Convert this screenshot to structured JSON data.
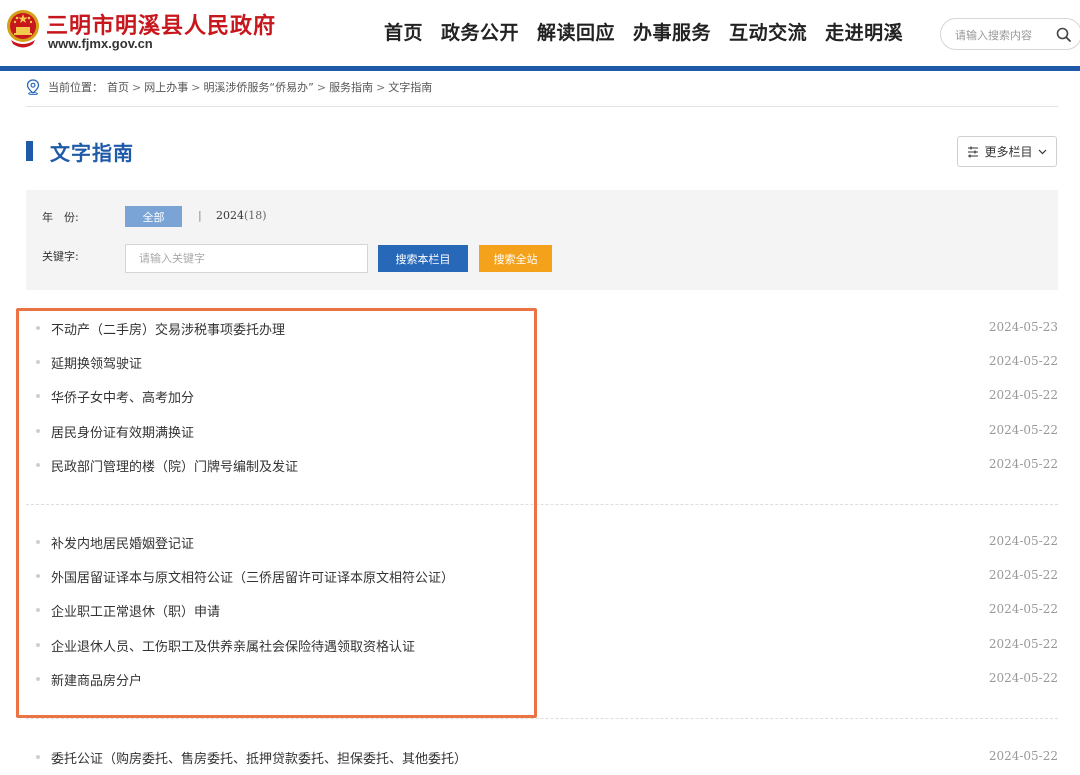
{
  "header": {
    "site_title": "三明市明溪县人民政府",
    "site_url": "www.fjmx.gov.cn",
    "nav": [
      "首页",
      "政务公开",
      "解读回应",
      "办事服务",
      "互动交流",
      "走进明溪"
    ],
    "search_placeholder": "请输入搜索内容"
  },
  "breadcrumb": {
    "prefix": "当前位置：",
    "items": [
      "首页",
      "网上办事",
      "明溪涉侨服务“侨易办”",
      "服务指南",
      "文字指南"
    ],
    "separator": ">"
  },
  "page": {
    "title": "文字指南",
    "more_label": "更多栏目"
  },
  "filter": {
    "year_label": "年　份:",
    "year_all": "全部",
    "year_sep": "|",
    "year_option": "2024",
    "year_count": "(18)",
    "keyword_label": "关键字:",
    "keyword_placeholder": "请输入关键字",
    "search_column": "搜索本栏目",
    "search_site": "搜索全站"
  },
  "list": [
    {
      "title": "不动产（二手房）交易涉税事项委托办理",
      "date": "2024-05-23"
    },
    {
      "title": "延期换领驾驶证",
      "date": "2024-05-22"
    },
    {
      "title": "华侨子女中考、高考加分",
      "date": "2024-05-22"
    },
    {
      "title": "居民身份证有效期满换证",
      "date": "2024-05-22"
    },
    {
      "title": "民政部门管理的楼（院）门牌号编制及发证",
      "date": "2024-05-22"
    },
    {
      "title": "补发内地居民婚姻登记证",
      "date": "2024-05-22"
    },
    {
      "title": "外国居留证译本与原文相符公证（三侨居留许可证译本原文相符公证）",
      "date": "2024-05-22"
    },
    {
      "title": "企业职工正常退休（职）申请",
      "date": "2024-05-22"
    },
    {
      "title": "企业退休人员、工伤职工及供养亲属社会保险待遇领取资格认证",
      "date": "2024-05-22"
    },
    {
      "title": "新建商品房分户",
      "date": "2024-05-22"
    },
    {
      "title": "委托公证（购房委托、售房委托、抵押贷款委托、担保委托、其他委托）",
      "date": "2024-05-22"
    }
  ],
  "colors": {
    "brand_blue": "#1e5aa8",
    "title_red": "#c8161d",
    "search_site_orange": "#f4a21b",
    "highlight_orange": "#ec7343"
  },
  "icons": {
    "logo": "national-emblem-icon",
    "search": "search-icon",
    "location": "location-pin-icon",
    "filter": "filter-icon",
    "chevron": "chevron-down-icon"
  }
}
